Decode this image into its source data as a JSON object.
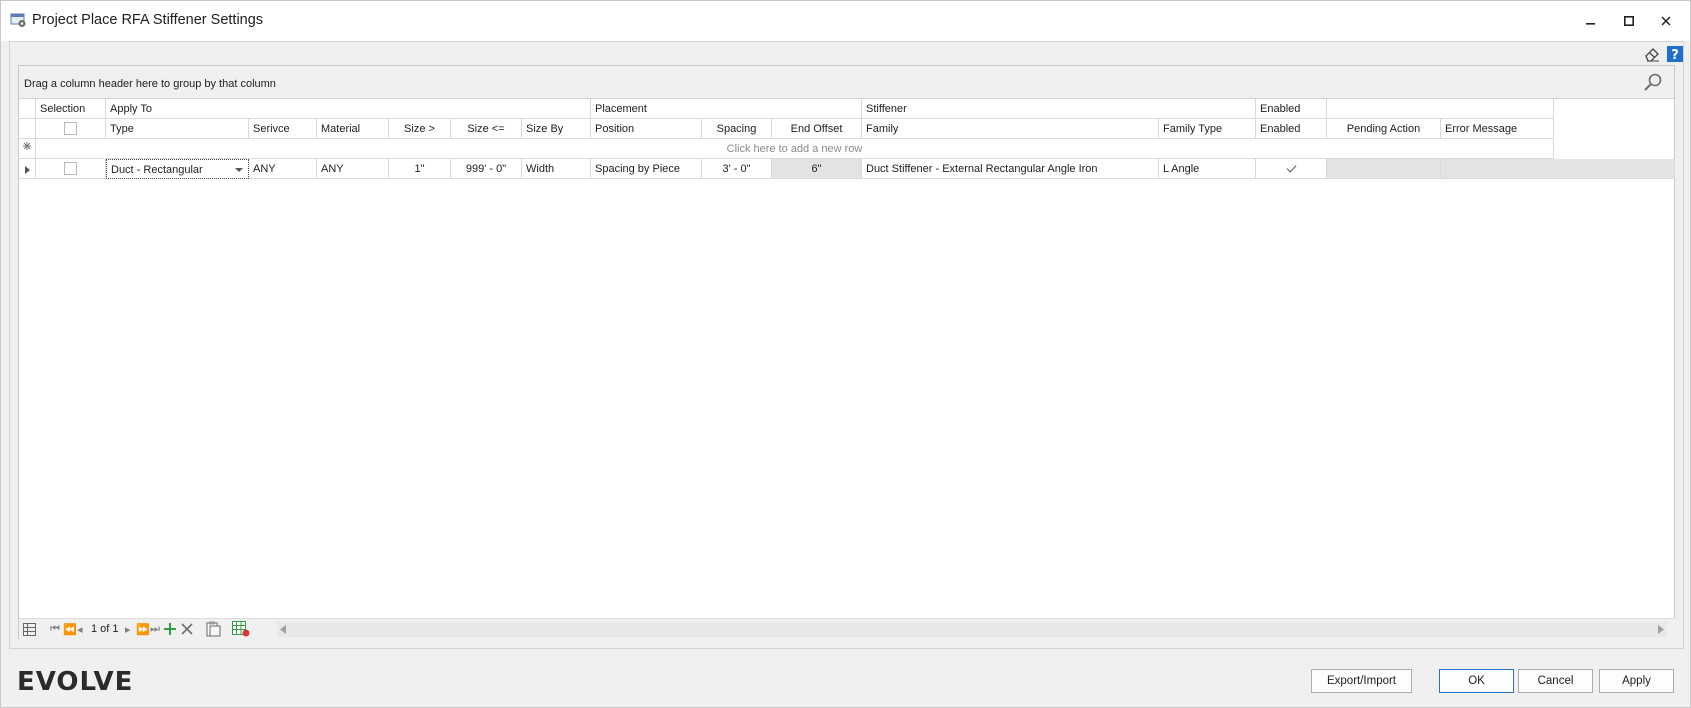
{
  "window": {
    "title": "Project Place RFA Stiffener Settings"
  },
  "grid": {
    "group_prompt": "Drag a column header here to group by that column",
    "bands": [
      "Selection",
      "Apply To",
      "Placement",
      "Stiffener",
      "Enabled",
      ""
    ],
    "columns": [
      "Type",
      "Serivce",
      "Material",
      "Size >",
      "Size <=",
      "Size By",
      "Position",
      "Spacing",
      "End Offset",
      "Family",
      "Family Type",
      "Enabled",
      "Pending Action",
      "Error Message"
    ],
    "new_row_text": "Click here to add a new row",
    "rows": [
      {
        "type": "Duct - Rectangular",
        "service": "ANY",
        "material": "ANY",
        "size_gt": "1\"",
        "size_le": "999' - 0\"",
        "size_by": "Width",
        "position": "Spacing by Piece",
        "spacing": "3' - 0\"",
        "end_offset": "6\"",
        "family": "Duct Stiffener - External Rectangular Angle Iron",
        "family_type": "L Angle",
        "enabled": true,
        "pending_action": "",
        "error_message": ""
      }
    ],
    "navigator": {
      "record_text": "1 of 1"
    }
  },
  "footer": {
    "logo": "EVOLVE",
    "export_import_label": "Export/Import",
    "ok_label": "OK",
    "cancel_label": "Cancel",
    "apply_label": "Apply"
  },
  "colors": {
    "accent": "#2b73c9",
    "add_green": "#2ea043",
    "delete_gray": "#6f6f6f",
    "help_blue": "#1e6fd0"
  },
  "icons": [
    "settings-window-icon",
    "minimize-icon",
    "maximize-icon",
    "close-icon",
    "eraser-icon",
    "help-icon",
    "search-icon",
    "new-row-icon",
    "row-indicator-icon",
    "first-icon",
    "prev-page-icon",
    "prev-icon",
    "next-icon",
    "next-page-icon",
    "last-icon",
    "add-icon",
    "delete-icon",
    "clipboard-icon",
    "grid-export-icon",
    "scroll-left-icon",
    "scroll-right-icon"
  ]
}
